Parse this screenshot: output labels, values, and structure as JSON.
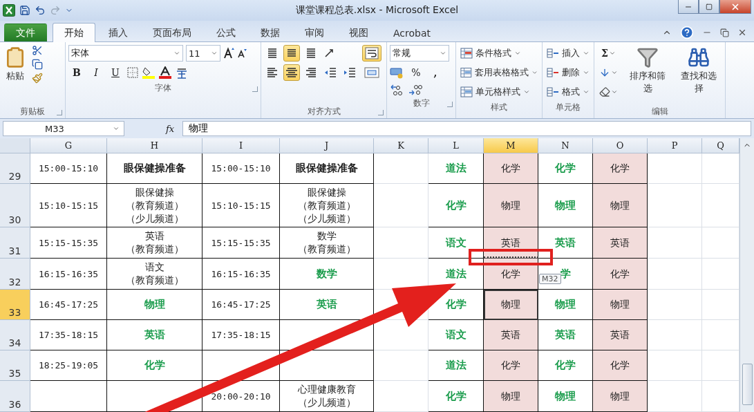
{
  "window": {
    "title": "课堂课程总表.xlsx - Microsoft Excel"
  },
  "ribbon_tabs": [
    {
      "label": "文件",
      "kind": "file",
      "selected": false
    },
    {
      "label": "开始",
      "kind": "tab",
      "selected": true
    },
    {
      "label": "插入",
      "kind": "tab",
      "selected": false
    },
    {
      "label": "页面布局",
      "kind": "tab",
      "selected": false
    },
    {
      "label": "公式",
      "kind": "tab",
      "selected": false
    },
    {
      "label": "数据",
      "kind": "tab",
      "selected": false
    },
    {
      "label": "审阅",
      "kind": "tab",
      "selected": false
    },
    {
      "label": "视图",
      "kind": "tab",
      "selected": false
    },
    {
      "label": "Acrobat",
      "kind": "tab",
      "selected": false
    }
  ],
  "clipboard": {
    "paste": "粘贴",
    "group": "剪贴板"
  },
  "font": {
    "font_name": "宋体",
    "font_size": "11",
    "bold": "B",
    "italic": "I",
    "underline": "U",
    "group": "字体"
  },
  "alignment": {
    "group": "对齐方式",
    "top_row": [
      {
        "kind": "top",
        "selected": false
      },
      {
        "kind": "middle",
        "selected": true
      },
      {
        "kind": "bottom",
        "selected": false
      },
      {
        "kind": "orientation",
        "selected": false
      }
    ],
    "bottom_row": [
      {
        "kind": "left",
        "selected": false
      },
      {
        "kind": "center",
        "selected": true
      },
      {
        "kind": "right",
        "selected": false
      },
      {
        "kind": "outdent",
        "selected": false
      },
      {
        "kind": "indent",
        "selected": false
      }
    ],
    "side": [
      {
        "kind": "wrap",
        "selected": true
      },
      {
        "kind": "merge",
        "selected": false
      }
    ]
  },
  "number": {
    "format": "常规",
    "percent": "%",
    "comma": ",",
    "group": "数字"
  },
  "styles": {
    "items": [
      "条件格式",
      "套用表格格式",
      "单元格样式"
    ],
    "group": "样式"
  },
  "cells": {
    "items": [
      "插入",
      "删除",
      "格式"
    ],
    "group": "单元格"
  },
  "editing": {
    "sum": "Σ",
    "sort": "排序和筛选",
    "find": "查找和选择",
    "group": "编辑"
  },
  "formula_bar": {
    "name_box": "M33",
    "fx": "fx",
    "value": "物理"
  },
  "columns": [
    {
      "label": "G",
      "selected": false,
      "shaded": false,
      "kind": "table"
    },
    {
      "label": "H",
      "selected": false,
      "shaded": false,
      "kind": "table"
    },
    {
      "label": "I",
      "selected": false,
      "shaded": false,
      "kind": "table"
    },
    {
      "label": "J",
      "selected": false,
      "shaded": false,
      "kind": "table"
    },
    {
      "label": "K",
      "selected": false,
      "shaded": false,
      "kind": "blank"
    },
    {
      "label": "L",
      "selected": false,
      "shaded": false,
      "kind": "table"
    },
    {
      "label": "M",
      "selected": true,
      "shaded": true,
      "kind": "table"
    },
    {
      "label": "N",
      "selected": false,
      "shaded": false,
      "kind": "table"
    },
    {
      "label": "O",
      "selected": false,
      "shaded": true,
      "kind": "table"
    },
    {
      "label": "P",
      "selected": false,
      "shaded": false,
      "kind": "blank"
    },
    {
      "label": "Q",
      "selected": false,
      "shaded": false,
      "kind": "blank"
    }
  ],
  "rows": [
    {
      "number": "29",
      "selected": false,
      "cells": [
        {
          "text": "15:00-15:10",
          "kind": "time",
          "selected": false
        },
        {
          "text": "眼保健操准备",
          "kind": "bold",
          "selected": false
        },
        {
          "text": "15:00-15:10",
          "kind": "time",
          "selected": false
        },
        {
          "text": "眼保健操准备",
          "kind": "bold",
          "selected": false
        },
        {
          "selected": false
        },
        {
          "text": "道法",
          "kind": "green",
          "selected": false
        },
        {
          "text": "化学",
          "kind": "normal",
          "selected": false
        },
        {
          "text": "化学",
          "kind": "green",
          "selected": false
        },
        {
          "text": "化学",
          "kind": "normal",
          "selected": false
        },
        {
          "selected": false
        },
        {
          "selected": false
        }
      ]
    },
    {
      "number": "30",
      "selected": false,
      "cells": [
        {
          "text": "15:10-15:15",
          "kind": "time",
          "selected": false
        },
        {
          "lines": [
            "眼保健操",
            "（教育频道）",
            "（少儿频道）"
          ],
          "kind": "normal",
          "selected": false
        },
        {
          "text": "15:10-15:15",
          "kind": "time",
          "selected": false
        },
        {
          "lines": [
            "眼保健操",
            "（教育频道）",
            "（少儿频道）"
          ],
          "kind": "normal",
          "selected": false
        },
        {
          "selected": false
        },
        {
          "text": "化学",
          "kind": "green",
          "selected": false
        },
        {
          "text": "物理",
          "kind": "normal",
          "selected": false
        },
        {
          "text": "物理",
          "kind": "green",
          "selected": false
        },
        {
          "text": "物理",
          "kind": "normal",
          "selected": false
        },
        {
          "selected": false
        },
        {
          "selected": false
        }
      ]
    },
    {
      "number": "31",
      "selected": false,
      "cells": [
        {
          "text": "15:15-15:35",
          "kind": "time",
          "selected": false
        },
        {
          "lines": [
            "英语",
            "（教育频道）"
          ],
          "kind": "normal",
          "selected": false
        },
        {
          "text": "15:15-15:35",
          "kind": "time",
          "selected": false
        },
        {
          "lines": [
            "数学",
            "（教育频道）"
          ],
          "kind": "normal",
          "selected": false
        },
        {
          "selected": false
        },
        {
          "text": "语文",
          "kind": "green",
          "selected": false
        },
        {
          "text": "英语",
          "kind": "normal",
          "selected": false
        },
        {
          "text": "英语",
          "kind": "green",
          "selected": false
        },
        {
          "text": "英语",
          "kind": "normal",
          "selected": false
        },
        {
          "selected": false
        },
        {
          "selected": false
        }
      ]
    },
    {
      "number": "32",
      "selected": false,
      "cells": [
        {
          "text": "16:15-16:35",
          "kind": "time",
          "selected": false
        },
        {
          "lines": [
            "语文",
            "（教育频道）"
          ],
          "kind": "normal",
          "selected": false
        },
        {
          "text": "16:15-16:35",
          "kind": "time",
          "selected": false
        },
        {
          "text": "数学",
          "kind": "green",
          "selected": false
        },
        {
          "selected": false
        },
        {
          "text": "道法",
          "kind": "green",
          "selected": false
        },
        {
          "text": "化学",
          "kind": "normal",
          "selected": false
        },
        {
          "text": "学",
          "kind": "green",
          "selected": false
        },
        {
          "text": "化学",
          "kind": "normal",
          "selected": false
        },
        {
          "selected": false
        },
        {
          "selected": false
        }
      ]
    },
    {
      "number": "33",
      "selected": true,
      "cells": [
        {
          "text": "16:45-17:25",
          "kind": "time",
          "selected": false
        },
        {
          "text": "物理",
          "kind": "green",
          "selected": false
        },
        {
          "text": "16:45-17:25",
          "kind": "time",
          "selected": false
        },
        {
          "text": "英语",
          "kind": "green",
          "selected": false
        },
        {
          "selected": false
        },
        {
          "text": "化学",
          "kind": "green",
          "selected": false
        },
        {
          "text": "物理",
          "kind": "normal",
          "selected": true
        },
        {
          "text": "物理",
          "kind": "green",
          "selected": false
        },
        {
          "text": "物理",
          "kind": "normal",
          "selected": false
        },
        {
          "selected": false
        },
        {
          "selected": false
        }
      ]
    },
    {
      "number": "34",
      "selected": false,
      "cells": [
        {
          "text": "17:35-18:15",
          "kind": "time",
          "selected": false
        },
        {
          "text": "英语",
          "kind": "green",
          "selected": false
        },
        {
          "text": "17:35-18:15",
          "kind": "time",
          "selected": false
        },
        {
          "selected": false
        },
        {
          "selected": false
        },
        {
          "text": "语文",
          "kind": "green",
          "selected": false
        },
        {
          "text": "英语",
          "kind": "normal",
          "selected": false
        },
        {
          "text": "英语",
          "kind": "green",
          "selected": false
        },
        {
          "text": "英语",
          "kind": "normal",
          "selected": false
        },
        {
          "selected": false
        },
        {
          "selected": false
        }
      ]
    },
    {
      "number": "35",
      "selected": false,
      "cells": [
        {
          "text": "18:25-19:05",
          "kind": "time",
          "selected": false
        },
        {
          "text": "化学",
          "kind": "green",
          "selected": false
        },
        {
          "selected": false
        },
        {
          "selected": false
        },
        {
          "selected": false
        },
        {
          "text": "道法",
          "kind": "green",
          "selected": false
        },
        {
          "text": "化学",
          "kind": "normal",
          "selected": false
        },
        {
          "text": "化学",
          "kind": "green",
          "selected": false
        },
        {
          "text": "化学",
          "kind": "normal",
          "selected": false
        },
        {
          "selected": false
        },
        {
          "selected": false
        }
      ]
    },
    {
      "number": "36",
      "selected": false,
      "cells": [
        {
          "selected": false
        },
        {
          "selected": false
        },
        {
          "text": "20:00-20:10",
          "kind": "time",
          "selected": false
        },
        {
          "lines": [
            "心理健康教育",
            "（少儿频道）"
          ],
          "kind": "normal",
          "selected": false
        },
        {
          "selected": false
        },
        {
          "text": "化学",
          "kind": "green",
          "selected": false
        },
        {
          "text": "物理",
          "kind": "normal",
          "selected": false
        },
        {
          "text": "物理",
          "kind": "green",
          "selected": false
        },
        {
          "text": "物理",
          "kind": "normal",
          "selected": false
        },
        {
          "selected": false
        },
        {
          "selected": false
        }
      ]
    }
  ],
  "tooltip": "M32"
}
